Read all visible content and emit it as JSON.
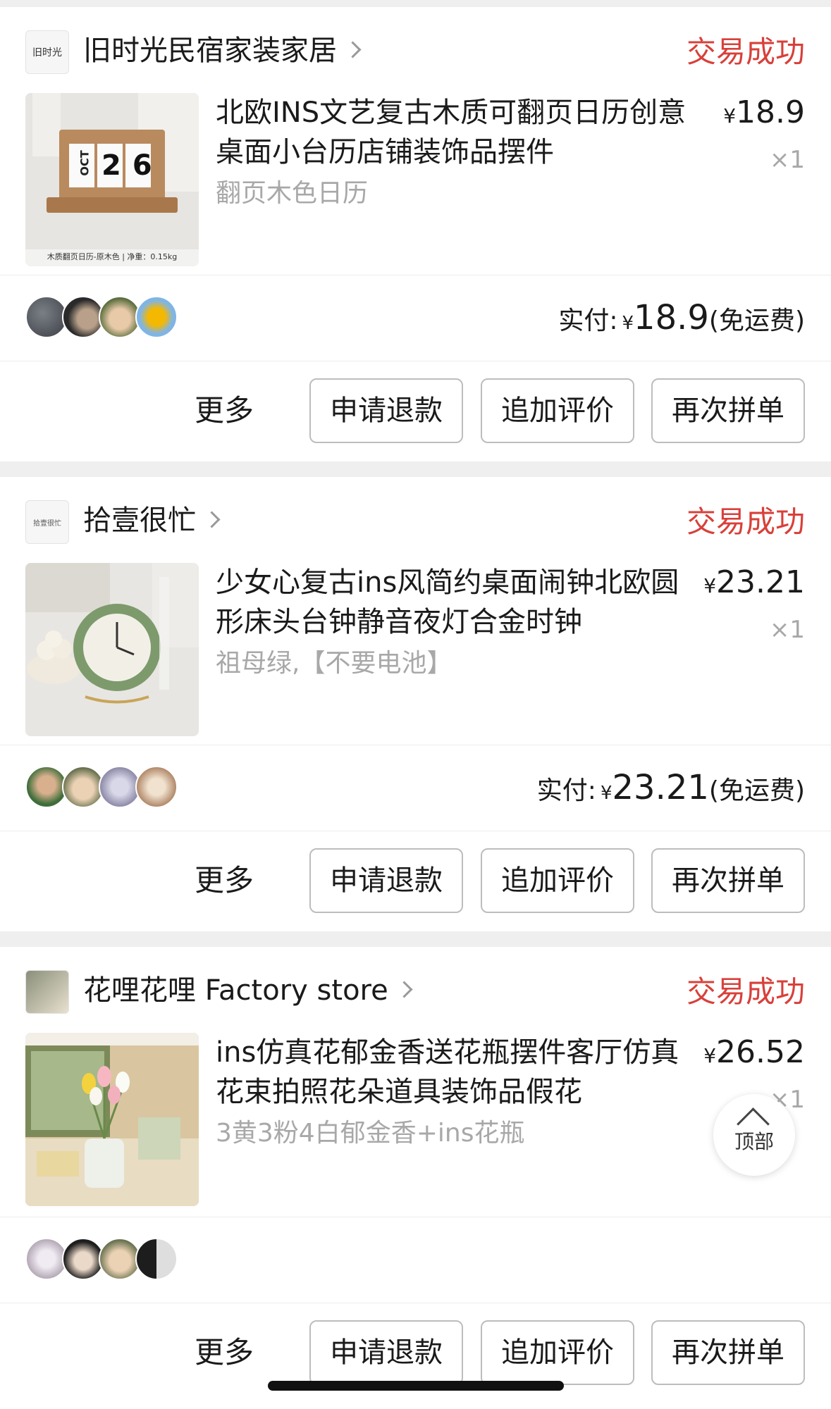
{
  "orders": [
    {
      "shop_name": "旧时光民宿家装家居",
      "shop_logo_text": "旧时光",
      "status": "交易成功",
      "item_title": "北欧INS文艺复古木质可翻页日历创意桌面小台历店铺装饰品摆件",
      "item_spec": "翻页木色日历",
      "price_symbol": "¥",
      "price": "18.9",
      "quantity": "×1",
      "thumb_month": "OCT",
      "thumb_day": "26",
      "thumb_caption": "木质翻页日历-原木色 | 净重：0.15kg",
      "paid_label": "实付:",
      "paid_symbol": "¥",
      "paid_amount": "18.9",
      "shipping_note": "(免运费)",
      "more_label": "更多",
      "refund_label": "申请退款",
      "review_label": "追加评价",
      "regroup_label": "再次拼单"
    },
    {
      "shop_name": "拾壹很忙",
      "shop_logo_text": "拾壹很忙",
      "status": "交易成功",
      "item_title": "少女心复古ins风简约桌面闹钟北欧圆形床头台钟静音夜灯合金时钟",
      "item_spec": "祖母绿,【不要电池】",
      "price_symbol": "¥",
      "price": "23.21",
      "quantity": "×1",
      "paid_label": "实付:",
      "paid_symbol": "¥",
      "paid_amount": "23.21",
      "shipping_note": "(免运费)",
      "more_label": "更多",
      "refund_label": "申请退款",
      "review_label": "追加评价",
      "regroup_label": "再次拼单"
    },
    {
      "shop_name": "花哩花哩 Factory store",
      "status": "交易成功",
      "item_title": "ins仿真花郁金香送花瓶摆件客厅仿真花束拍照花朵道具装饰品假花",
      "item_spec": "3黄3粉4白郁金香+ins花瓶",
      "price_symbol": "¥",
      "price": "26.52",
      "quantity": "×1",
      "more_label": "更多",
      "refund_label": "申请退款",
      "review_label": "追加评价",
      "regroup_label": "再次拼单"
    }
  ],
  "back_to_top_label": "顶部",
  "colors": {
    "status": "#d8403a",
    "page_bg": "#efefef",
    "button_border": "#bdbdbd"
  }
}
